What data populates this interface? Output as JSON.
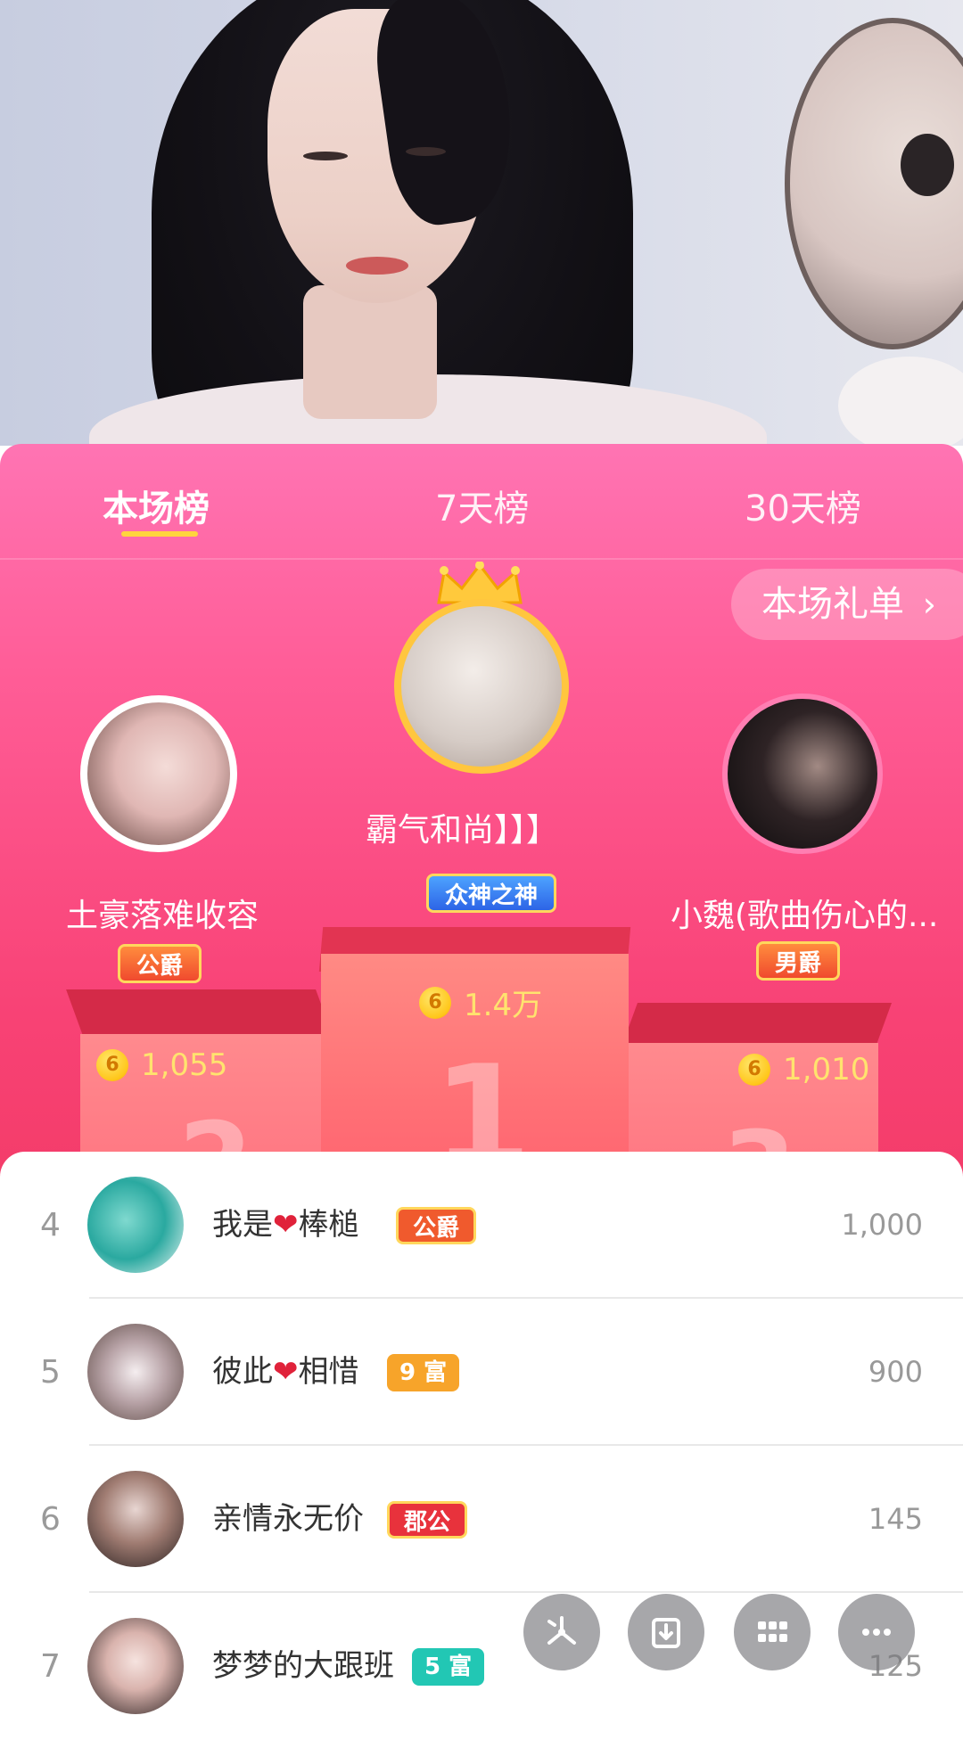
{
  "tabs": [
    {
      "label": "本场榜",
      "active": true
    },
    {
      "label": "7天榜",
      "active": false
    },
    {
      "label": "30天榜",
      "active": false
    }
  ],
  "gift_list_button": {
    "label": "本场礼单",
    "chevron": "›"
  },
  "podium": {
    "first": {
      "rank": "1",
      "name": "霸气和尚】】】",
      "badge": "众神之神",
      "score": "1.4万"
    },
    "second": {
      "rank": "2",
      "name": "土豪落难收容",
      "badge": "公爵",
      "score": "1,055"
    },
    "third": {
      "rank": "3",
      "name": "小魏(歌曲伤心的...",
      "badge": "男爵",
      "score": "1,010"
    }
  },
  "coin_glyph": "6",
  "list": [
    {
      "rank": "4",
      "name_a": "我是",
      "name_b": "棒槌",
      "has_heart": true,
      "badge": "公爵",
      "badge_color": "#f05a2d",
      "value": "1,000"
    },
    {
      "rank": "5",
      "name_a": "彼此",
      "name_b": "相惜",
      "has_heart": true,
      "badge": "9 富",
      "badge_color": "#f7a42a",
      "value": "900"
    },
    {
      "rank": "6",
      "name_a": "亲情永无价",
      "name_b": "",
      "has_heart": false,
      "badge": "郡公",
      "badge_color": "#e8323c",
      "value": "145"
    },
    {
      "rank": "7",
      "name_a": "梦梦的大跟班",
      "name_b": "",
      "has_heart": false,
      "badge": "5 富",
      "badge_color": "#22c7b4",
      "value": "125"
    }
  ],
  "heart_glyph": "❤",
  "fab_icons": [
    "share-icon",
    "download-icon",
    "grid-icon",
    "more-icon"
  ],
  "colors": {
    "accent_pink": "#ff5d97",
    "gold": "#ffc63e",
    "tab_underline": "#ffd53d"
  }
}
